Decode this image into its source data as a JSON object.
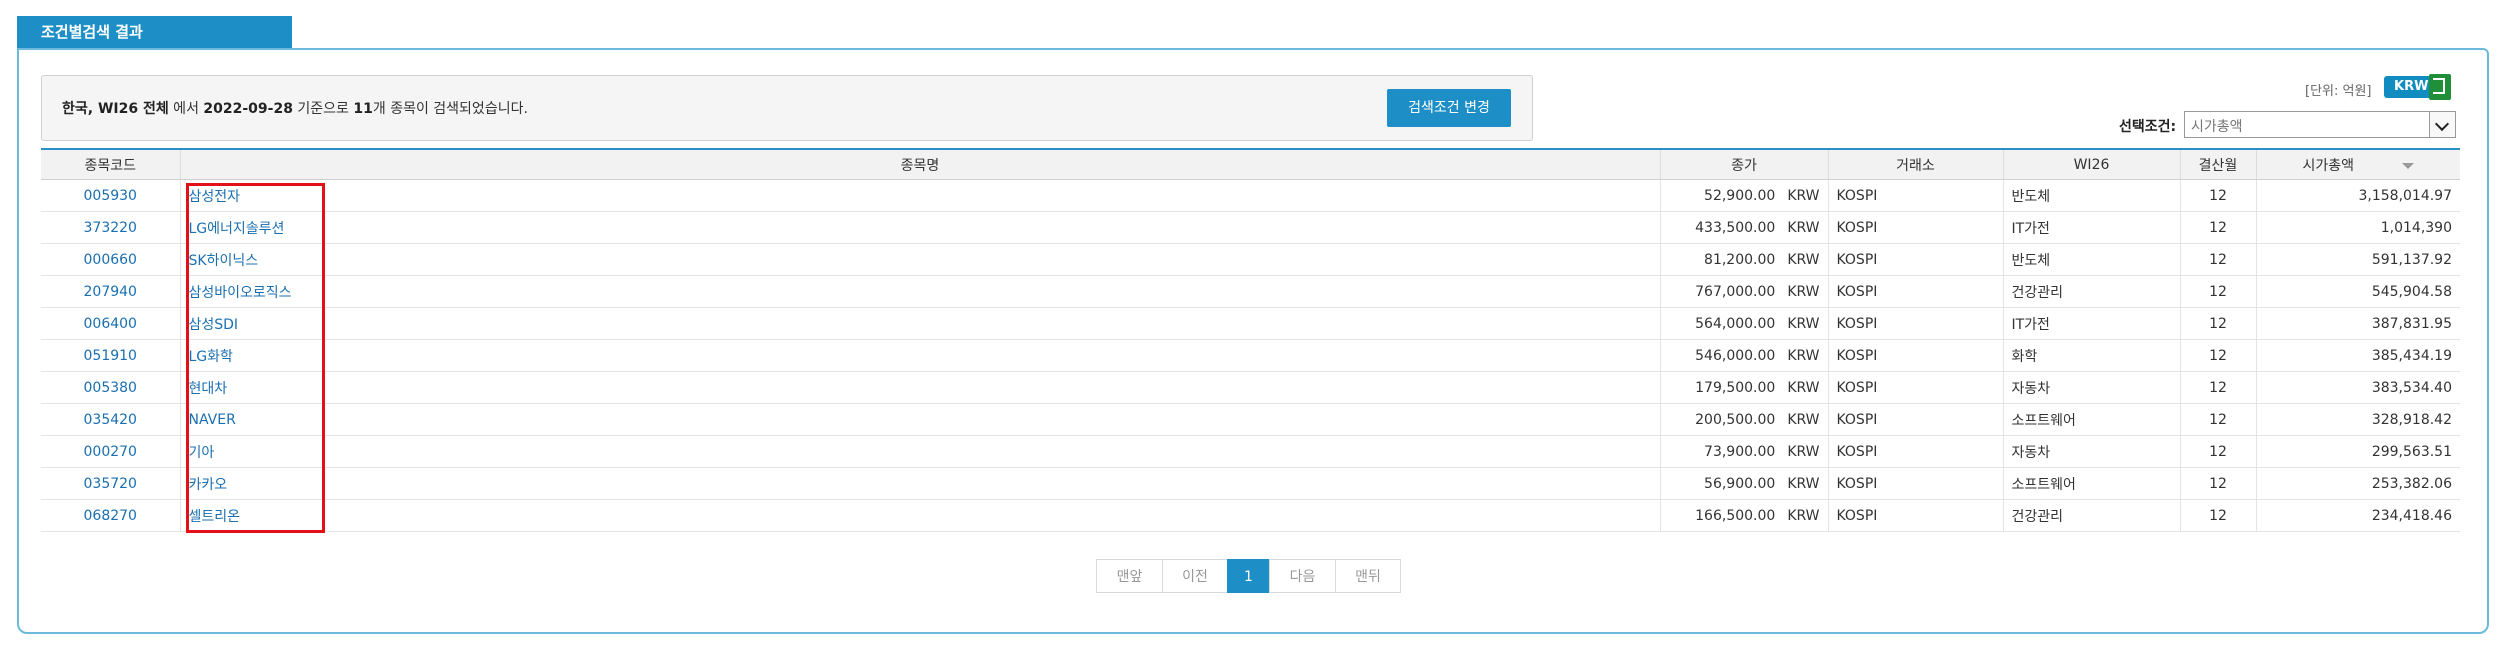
{
  "tab": {
    "title": "조건별검색 결과"
  },
  "summary": {
    "country": "한국, WI26 전체",
    "text_middle": " 에서 ",
    "date": "2022-09-28",
    "text_base": " 기준으로 ",
    "count": "11",
    "text_end": "개 종목이 검색되었습니다.",
    "change_button": "검색조건 변경"
  },
  "unit": {
    "label": "[단위: 억원]",
    "currency_badge": "KRW"
  },
  "select": {
    "label": "선택조건:",
    "value": "시가총액"
  },
  "table": {
    "headers": [
      "종목코드",
      "종목명",
      "종가",
      "거래소",
      "WI26",
      "결산월",
      "시가총액"
    ],
    "rows": [
      {
        "code": "005930",
        "name": "삼성전자",
        "price": "52,900.00",
        "currency": "KRW",
        "exchange": "KOSPI",
        "sector": "반도체",
        "month": "12",
        "cap": "3,158,014.97"
      },
      {
        "code": "373220",
        "name": "LG에너지솔루션",
        "price": "433,500.00",
        "currency": "KRW",
        "exchange": "KOSPI",
        "sector": "IT가전",
        "month": "12",
        "cap": "1,014,390"
      },
      {
        "code": "000660",
        "name": "SK하이닉스",
        "price": "81,200.00",
        "currency": "KRW",
        "exchange": "KOSPI",
        "sector": "반도체",
        "month": "12",
        "cap": "591,137.92"
      },
      {
        "code": "207940",
        "name": "삼성바이오로직스",
        "price": "767,000.00",
        "currency": "KRW",
        "exchange": "KOSPI",
        "sector": "건강관리",
        "month": "12",
        "cap": "545,904.58"
      },
      {
        "code": "006400",
        "name": "삼성SDI",
        "price": "564,000.00",
        "currency": "KRW",
        "exchange": "KOSPI",
        "sector": "IT가전",
        "month": "12",
        "cap": "387,831.95"
      },
      {
        "code": "051910",
        "name": "LG화학",
        "price": "546,000.00",
        "currency": "KRW",
        "exchange": "KOSPI",
        "sector": "화학",
        "month": "12",
        "cap": "385,434.19"
      },
      {
        "code": "005380",
        "name": "현대차",
        "price": "179,500.00",
        "currency": "KRW",
        "exchange": "KOSPI",
        "sector": "자동차",
        "month": "12",
        "cap": "383,534.40"
      },
      {
        "code": "035420",
        "name": "NAVER",
        "price": "200,500.00",
        "currency": "KRW",
        "exchange": "KOSPI",
        "sector": "소프트웨어",
        "month": "12",
        "cap": "328,918.42"
      },
      {
        "code": "000270",
        "name": "기아",
        "price": "73,900.00",
        "currency": "KRW",
        "exchange": "KOSPI",
        "sector": "자동차",
        "month": "12",
        "cap": "299,563.51"
      },
      {
        "code": "035720",
        "name": "카카오",
        "price": "56,900.00",
        "currency": "KRW",
        "exchange": "KOSPI",
        "sector": "소프트웨어",
        "month": "12",
        "cap": "253,382.06"
      },
      {
        "code": "068270",
        "name": "셀트리온",
        "price": "166,500.00",
        "currency": "KRW",
        "exchange": "KOSPI",
        "sector": "건강관리",
        "month": "12",
        "cap": "234,418.46"
      }
    ]
  },
  "pagination": {
    "first": "맨앞",
    "prev": "이전",
    "current": "1",
    "next": "다음",
    "last": "맨뒤"
  },
  "colors": {
    "accent": "#1e8fc6",
    "highlight": "#e3101a",
    "link": "#1a6fb0"
  }
}
